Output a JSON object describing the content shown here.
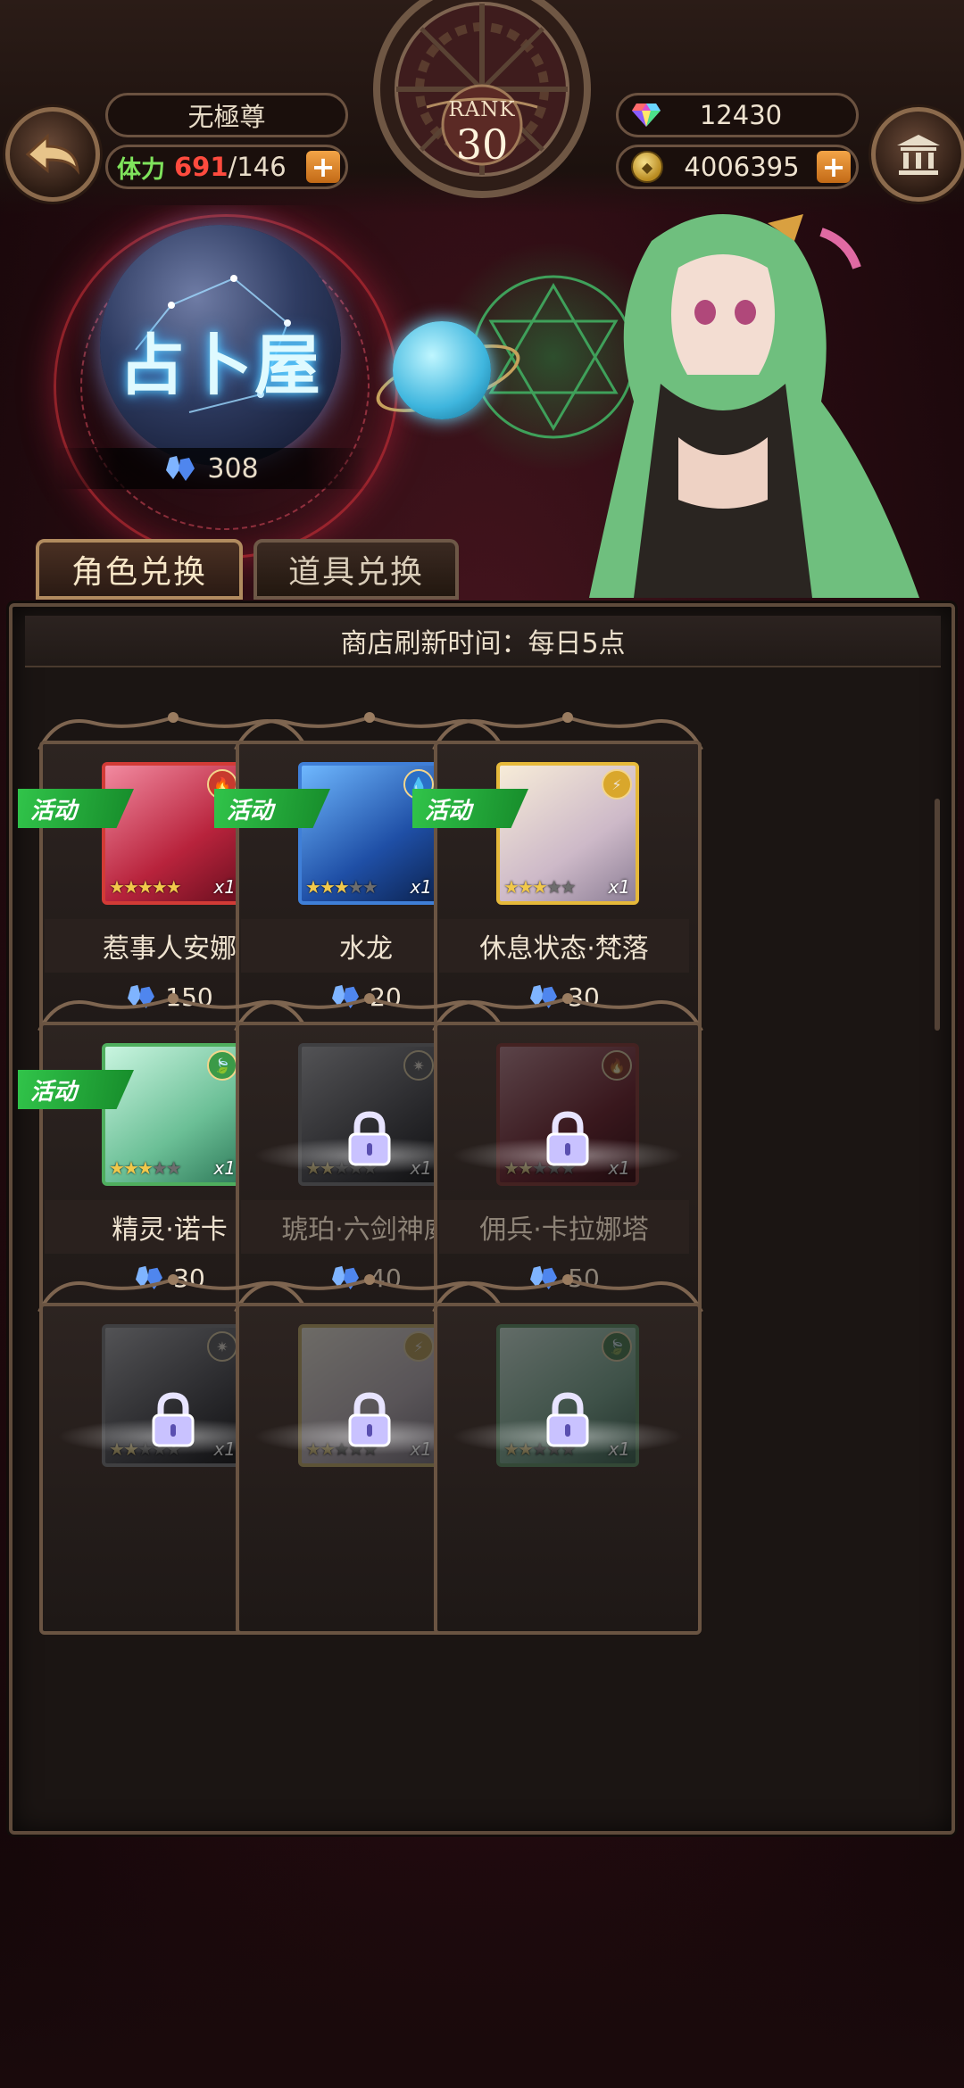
{
  "player": {
    "name": "无極尊"
  },
  "stamina": {
    "label": "体力",
    "current": "691",
    "max": "/146"
  },
  "rank": {
    "label": "RANK",
    "value": "30"
  },
  "currency": {
    "gems": "12430",
    "gold": "4006395"
  },
  "shop": {
    "title": "占卜屋",
    "crystal_count": "308"
  },
  "tabs": [
    {
      "label": "角色兑换"
    },
    {
      "label": "道具兑换"
    }
  ],
  "refresh_text": "商店刷新时间：每日5点",
  "badge_label": "活动",
  "items": [
    {
      "name": "惹事人安娜",
      "price": "150",
      "stars": 5,
      "multiplier": "x1",
      "element": "fire",
      "locked": false,
      "event": true
    },
    {
      "name": "水龙",
      "price": "20",
      "stars": 3,
      "multiplier": "x1",
      "element": "water",
      "locked": false,
      "event": true
    },
    {
      "name": "休息状态·梵落",
      "price": "30",
      "stars": 3,
      "multiplier": "x1",
      "element": "thunder",
      "locked": false,
      "event": true
    },
    {
      "name": "精灵·诺卡",
      "price": "30",
      "stars": 3,
      "multiplier": "x1",
      "element": "wind",
      "locked": false,
      "event": true
    },
    {
      "name": "琥珀·六剑神威",
      "price": "40",
      "stars": 2,
      "multiplier": "x1",
      "element": "dark",
      "locked": true,
      "event": false
    },
    {
      "name": "佣兵·卡拉娜塔",
      "price": "50",
      "stars": 2,
      "multiplier": "x1",
      "element": "fire",
      "locked": true,
      "event": false
    },
    {
      "stars": 2,
      "multiplier": "x1",
      "element": "dark",
      "locked": true,
      "event": false
    },
    {
      "stars": 2,
      "multiplier": "x1",
      "element": "thunder",
      "locked": true,
      "event": false
    },
    {
      "stars": 2,
      "multiplier": "x1",
      "element": "wind",
      "locked": true,
      "event": false
    }
  ],
  "colors": {
    "fire": "#c73a2e",
    "water": "#2b6fc7",
    "thunder": "#d9a72c",
    "wind": "#3b9a48",
    "dark": "#6e6e7a"
  }
}
